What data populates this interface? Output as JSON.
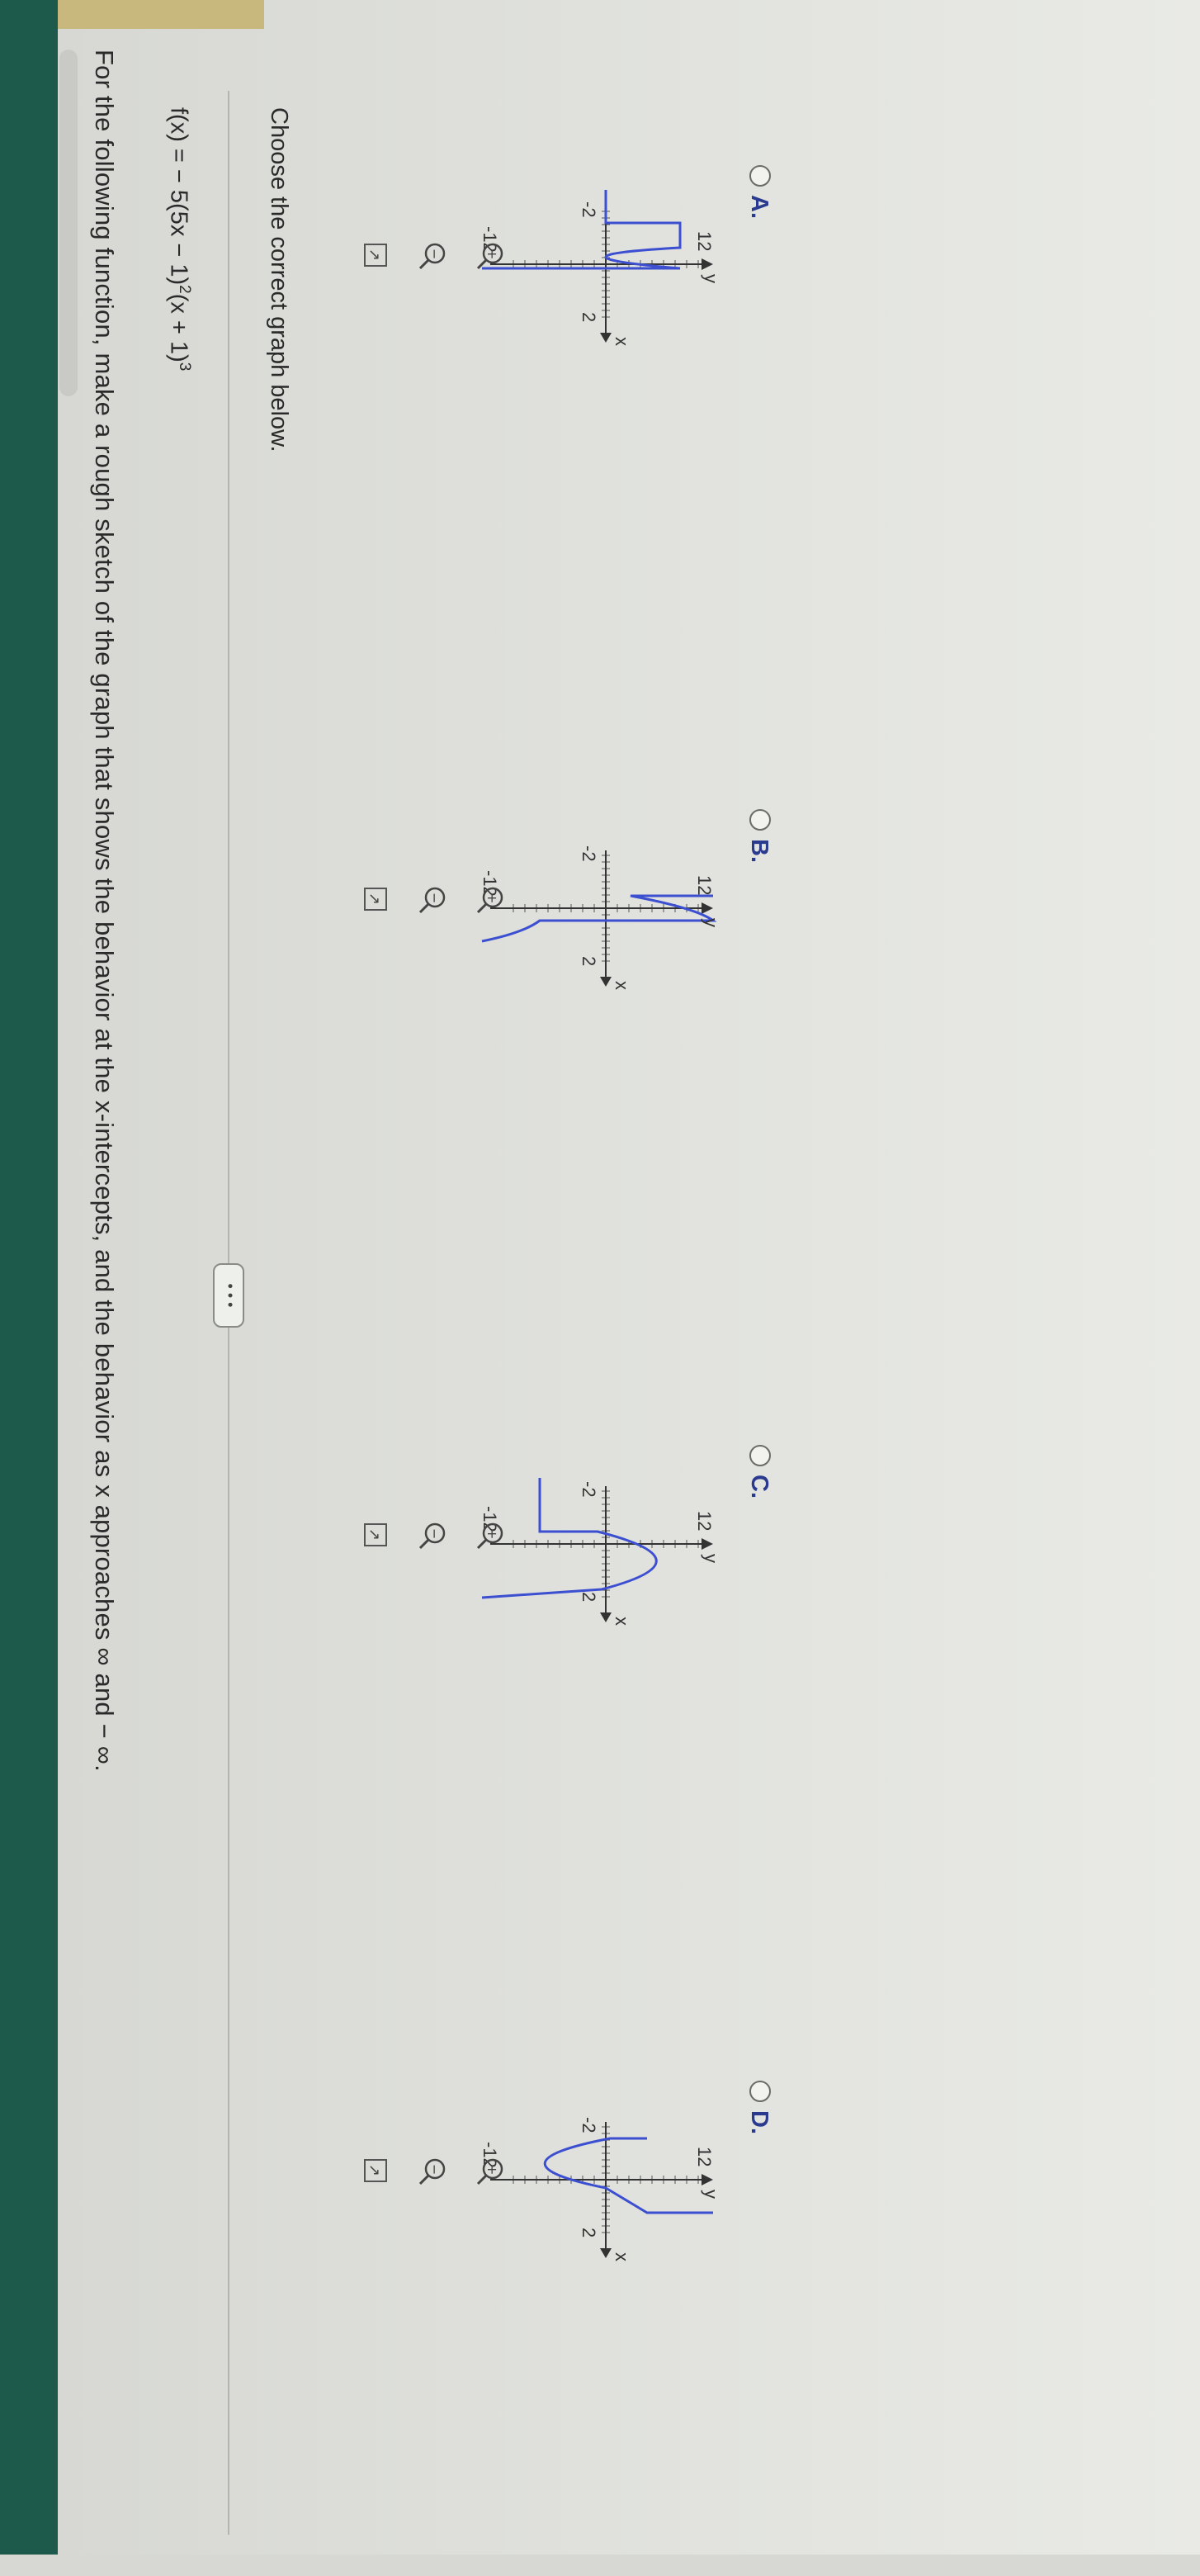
{
  "question": "For the following function, make a rough sketch of the graph that shows the behavior at the x-intercepts, and the behavior as x approaches ∞ and − ∞.",
  "function": {
    "lhs": "f(x) = − 5(5x − 1)",
    "exp1": "2",
    "mid": "(x + 1)",
    "exp2": "3"
  },
  "more_button": "• • •",
  "instruction": "Choose the correct graph below.",
  "options": [
    {
      "letter": "A.",
      "ymax": "12",
      "ymin": "-12",
      "xmin": "-2",
      "xmax": "2",
      "xaxis": "x",
      "yaxis": "y"
    },
    {
      "letter": "B.",
      "ymax": "12",
      "ymin": "-12",
      "xmin": "-2",
      "xmax": "2",
      "xaxis": "x",
      "yaxis": "y"
    },
    {
      "letter": "C.",
      "ymax": "12",
      "ymin": "-12",
      "xmin": "-2",
      "xmax": "2",
      "xaxis": "x",
      "yaxis": "y"
    },
    {
      "letter": "D.",
      "ymax": "12",
      "ymin": "-12",
      "xmin": "-2",
      "xmax": "2",
      "xaxis": "x",
      "yaxis": "y"
    }
  ],
  "icons": [
    "zoom-in-icon",
    "zoom-out-icon",
    "popout-icon"
  ],
  "colors": {
    "curve": "#3b4fd0",
    "label": "#2a3a8f"
  }
}
